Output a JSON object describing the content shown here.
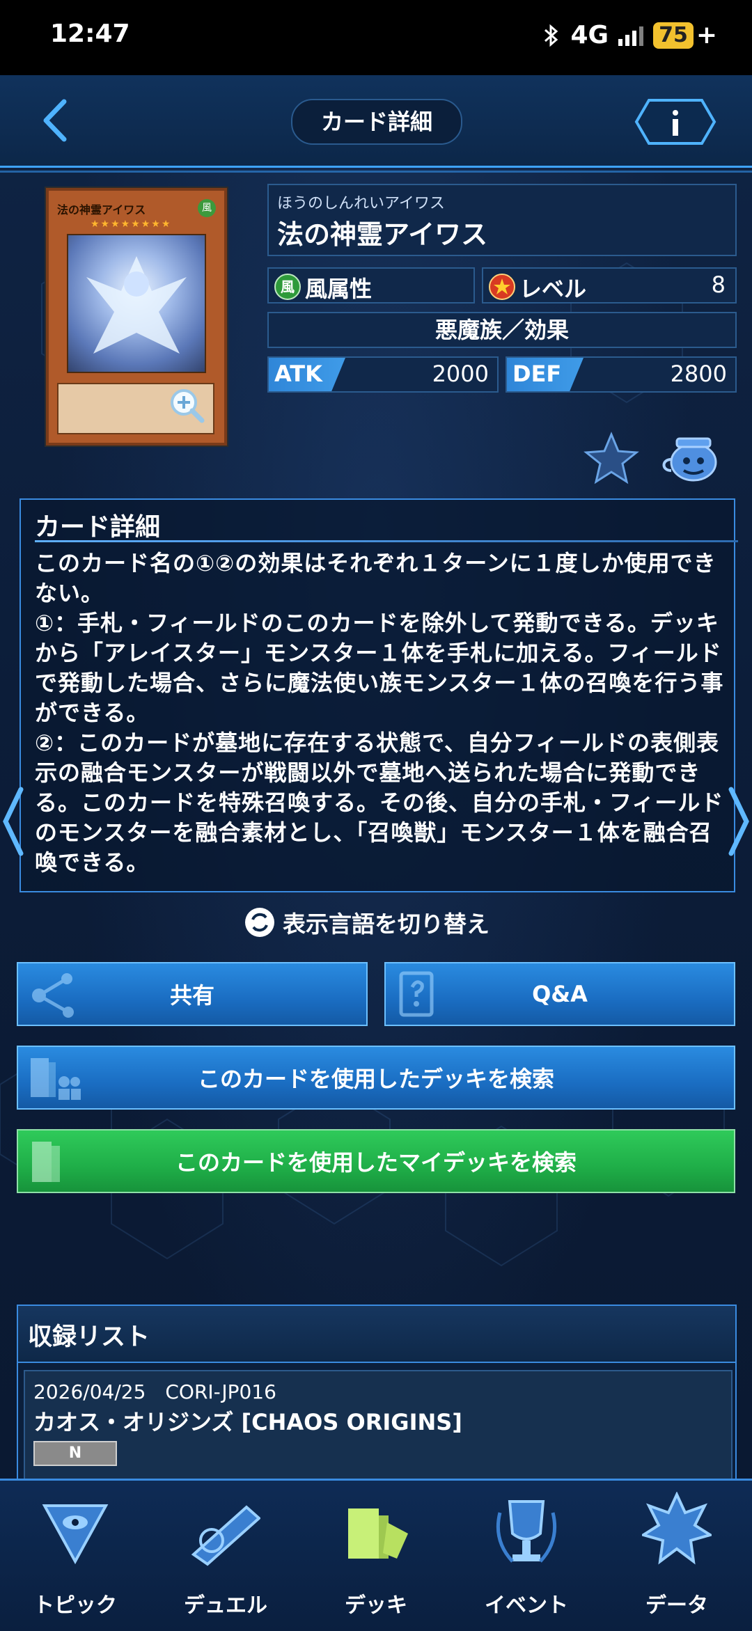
{
  "status": {
    "time": "12:47",
    "network": "4G",
    "battery": "75",
    "charging": "+"
  },
  "header": {
    "title": "カード詳細"
  },
  "card": {
    "kana": "ほうのしんれいアイワス",
    "name": "法の神霊アイワス",
    "attribute_icon": "風",
    "attribute": "風属性",
    "level_label": "レベル",
    "level": "8",
    "type": "悪魔族／効果",
    "atk_label": "ATK",
    "atk": "2000",
    "def_label": "DEF",
    "def": "2800",
    "image_name": "法の神霊アイワス"
  },
  "description": {
    "title": "カード詳細",
    "text": "このカード名の①②の効果はそれぞれ１ターンに１度しか使用できない。\n①：手札・フィールドのこのカードを除外して発動できる。デッキから「アレイスター」モンスター１体を手札に加える。フィールドで発動した場合、さらに魔法使い族モンスター１体の召喚を行う事ができる。\n②：このカードが墓地に存在する状態で、自分フィールドの表側表示の融合モンスターが戦闘以外で墓地へ送られた場合に発動できる。このカードを特殊召喚する。その後、自分の手札・フィールドのモンスターを融合素材とし、「召喚獣」モンスター１体を融合召喚できる。"
  },
  "lang_switch": "表示言語を切り替え",
  "buttons": {
    "share": "共有",
    "qa": "Q&A",
    "deck_search": "このカードを使用したデッキを検索",
    "mydeck_search": "このカードを使用したマイデッキを検索"
  },
  "release_list": {
    "title": "収録リスト",
    "items": [
      {
        "date_code": "2026/04/25　CORI-JP016",
        "name": "カオス・オリジンズ [CHAOS ORIGINS]",
        "rarity": "N"
      }
    ]
  },
  "nav": [
    {
      "label": "トピック",
      "icon": "topic-icon"
    },
    {
      "label": "デュエル",
      "icon": "duel-icon"
    },
    {
      "label": "デッキ",
      "icon": "deck-icon"
    },
    {
      "label": "イベント",
      "icon": "event-icon"
    },
    {
      "label": "データ",
      "icon": "data-icon"
    }
  ],
  "colors": {
    "accent": "#3ea3ff",
    "deck_active": "#c8f078",
    "green": "#1fae48"
  }
}
